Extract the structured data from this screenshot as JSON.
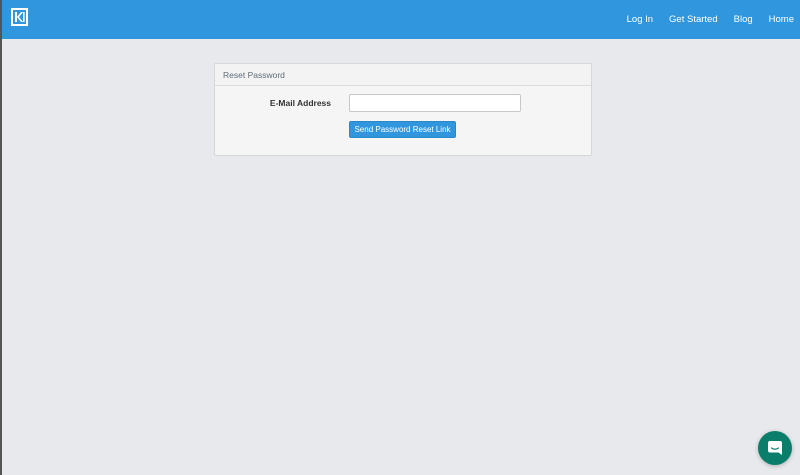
{
  "navbar": {
    "brand_icon": "kl-logo",
    "links": [
      {
        "label": "Log In"
      },
      {
        "label": "Get Started"
      },
      {
        "label": "Blog"
      },
      {
        "label": "Home"
      }
    ],
    "background_color": "#3097de"
  },
  "reset_panel": {
    "heading": "Reset Password",
    "email_label": "E-Mail Address",
    "email_value": "",
    "email_placeholder": "",
    "submit_label": "Send Password Reset Link"
  },
  "chat_launcher": {
    "icon": "chat-bubble-icon",
    "color": "#0b7e6b"
  }
}
